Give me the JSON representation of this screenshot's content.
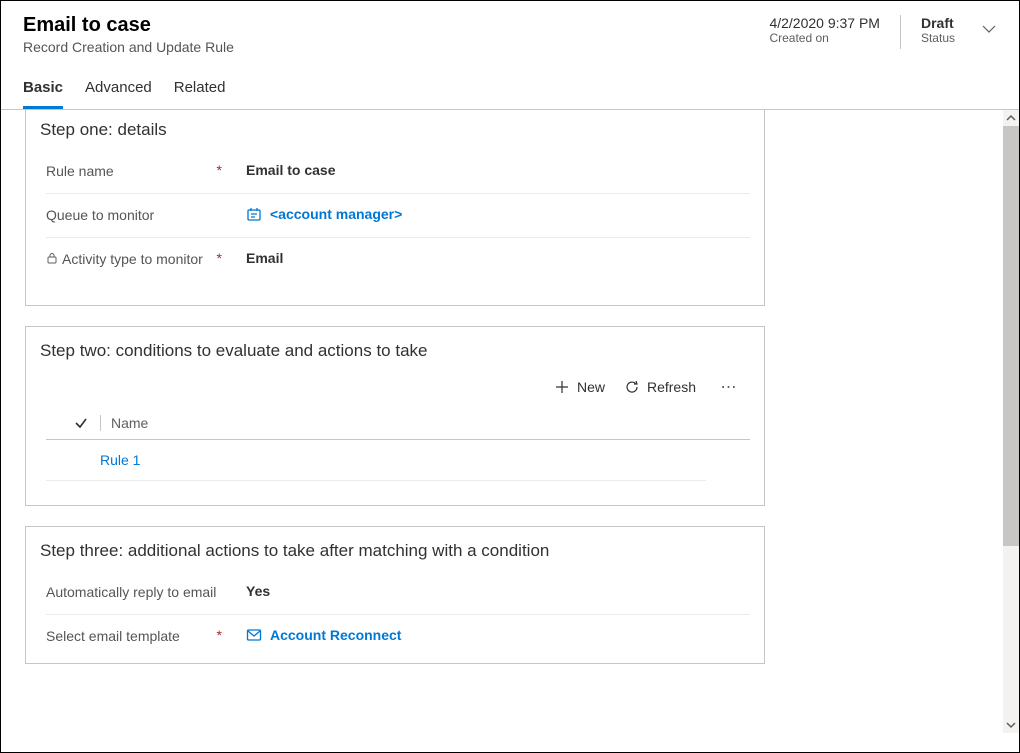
{
  "header": {
    "title": "Email to case",
    "subtitle": "Record Creation and Update Rule",
    "created_on_value": "4/2/2020 9:37 PM",
    "created_on_label": "Created on",
    "status_value": "Draft",
    "status_label": "Status"
  },
  "tabs": {
    "basic": "Basic",
    "advanced": "Advanced",
    "related": "Related"
  },
  "step_one": {
    "title": "Step one: details",
    "rule_name_label": "Rule name",
    "rule_name_value": "Email to case",
    "queue_label": "Queue to monitor",
    "queue_value": "<account manager>",
    "activity_label": "Activity type to monitor",
    "activity_value": "Email"
  },
  "step_two": {
    "title": "Step two: conditions to evaluate and actions to take",
    "new_label": "New",
    "refresh_label": "Refresh",
    "grid_col_name": "Name",
    "rows": {
      "r0": "Rule 1"
    }
  },
  "step_three": {
    "title": "Step three: additional actions to take after matching with a condition",
    "auto_reply_label": "Automatically reply to email",
    "auto_reply_value": "Yes",
    "template_label": "Select email template",
    "template_value": "Account Reconnect"
  }
}
